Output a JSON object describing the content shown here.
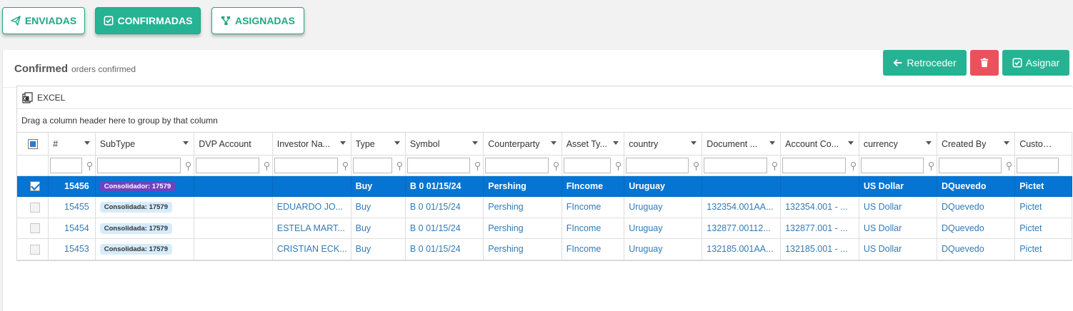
{
  "tabs": [
    {
      "label": "ENVIADAS",
      "icon": "paper-plane-icon"
    },
    {
      "label": "CONFIRMADAS",
      "icon": "check-square-icon"
    },
    {
      "label": "ASIGNADAS",
      "icon": "sitemap-icon"
    }
  ],
  "panel": {
    "title": "Confirmed",
    "subtitle": "orders confirmed"
  },
  "actions": {
    "retroceder": "Retroceder",
    "asignar": "Asignar"
  },
  "toolbar": {
    "excel_label": "EXCEL"
  },
  "grid": {
    "group_hint": "Drag a column header here to group by that column",
    "columns": [
      "#",
      "SubType",
      "DVP Account",
      "Investor Na...",
      "Type",
      "Symbol",
      "Counterparty",
      "Asset Ty...",
      "country",
      "Document ...",
      "Account Co...",
      "currency",
      "Created By",
      "Custodian"
    ],
    "rows": [
      {
        "id": "15456",
        "subtype": "Consolidador: 17579",
        "dvp": "",
        "investor": "",
        "type": "Buy",
        "symbol": "B 0 01/15/24",
        "counterparty": "Pershing",
        "asset": "FIncome",
        "country": "Uruguay",
        "document": "",
        "account": "",
        "currency": "US Dollar",
        "created_by": "DQuevedo",
        "custodian": "Pictet"
      },
      {
        "id": "15455",
        "subtype": "Consolidada: 17579",
        "dvp": "",
        "investor": "EDUARDO JO...",
        "type": "Buy",
        "symbol": "B 0 01/15/24",
        "counterparty": "Pershing",
        "asset": "FIncome",
        "country": "Uruguay",
        "document": "132354.001AA...",
        "account": "132354.001 - ...",
        "currency": "US Dollar",
        "created_by": "DQuevedo",
        "custodian": "Pictet"
      },
      {
        "id": "15454",
        "subtype": "Consolidada: 17579",
        "dvp": "",
        "investor": "ESTELA MART...",
        "type": "Buy",
        "symbol": "B 0 01/15/24",
        "counterparty": "Pershing",
        "asset": "FIncome",
        "country": "Uruguay",
        "document": "132877.00112...",
        "account": "132877.001 - ...",
        "currency": "US Dollar",
        "created_by": "DQuevedo",
        "custodian": "Pictet"
      },
      {
        "id": "15453",
        "subtype": "Consolidada: 17579",
        "dvp": "",
        "investor": "CRISTIAN ECK...",
        "type": "Buy",
        "symbol": "B 0 01/15/24",
        "counterparty": "Pershing",
        "asset": "FIncome",
        "country": "Uruguay",
        "document": "132185.001AA...",
        "account": "132185.001 - ...",
        "currency": "US Dollar",
        "created_by": "DQuevedo",
        "custodian": "Pictet"
      }
    ]
  },
  "colors": {
    "accent": "#26b394",
    "selected_row": "#0574d2",
    "danger": "#e9525c",
    "link": "#337ab7",
    "badge_purple": "#6f42c1",
    "badge_light": "#d6ecfb"
  }
}
